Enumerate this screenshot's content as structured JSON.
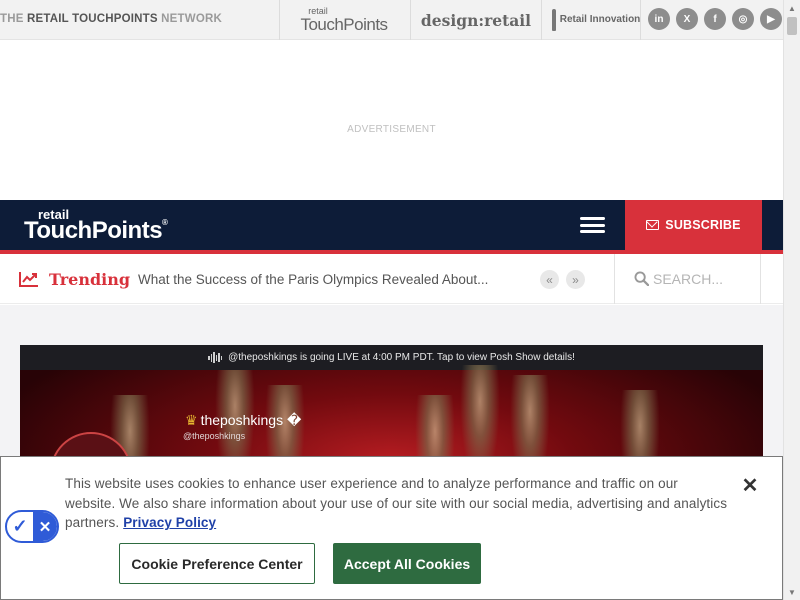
{
  "network": {
    "label_prefix": "THE",
    "label_name": "RETAIL TOUCHPOINTS",
    "label_suffix": "NETWORK",
    "logos": {
      "rtp_small": "retail",
      "rtp_big": "TouchPoints",
      "design_retail": "design:retail",
      "innovation": "Retail Innovation"
    },
    "socials": [
      {
        "icon": "linkedin-icon",
        "glyph": "in"
      },
      {
        "icon": "x-icon",
        "glyph": "X"
      },
      {
        "icon": "facebook-icon",
        "glyph": "f"
      },
      {
        "icon": "instagram-icon",
        "glyph": "◎"
      },
      {
        "icon": "youtube-icon",
        "glyph": "▶"
      }
    ]
  },
  "ad": {
    "label": "ADVERTISEMENT"
  },
  "header": {
    "logo_small": "retail",
    "logo_big": "TouchPoints",
    "logo_reg": "®",
    "subscribe_label": "SUBSCRIBE"
  },
  "trending": {
    "label": "Trending",
    "headline": "What the Success of the Paris Olympics Revealed About...",
    "prev_glyph": "«",
    "next_glyph": "»"
  },
  "search": {
    "placeholder": "SEARCH..."
  },
  "embed": {
    "banner": "@theposhkings is going LIVE at 4:00 PM PDT. Tap to view Posh Show details!",
    "crown": "♛",
    "name": "theposhkings �",
    "handle": "@theposhkings"
  },
  "cookie": {
    "text": "This website uses cookies to enhance user experience and to analyze performance and traffic on our website. We also share information about your use of our site with our social media, advertising and analytics partners.",
    "privacy_link": "Privacy Policy",
    "close_glyph": "✕",
    "pref_button": "Cookie Preference Center",
    "accept_button": "Accept All Cookies",
    "badge_check": "✓",
    "badge_x": "✕"
  },
  "colors": {
    "nav_bg": "#0d1c38",
    "accent_red": "#d8313b",
    "accept_green": "#2e6b40",
    "consent_blue": "#2f5bd7"
  }
}
